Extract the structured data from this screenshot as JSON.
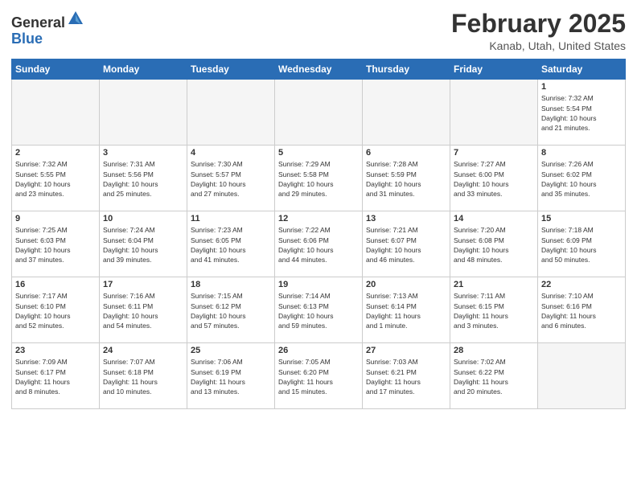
{
  "header": {
    "logo_line1": "General",
    "logo_line2": "Blue",
    "title": "February 2025",
    "subtitle": "Kanab, Utah, United States"
  },
  "weekdays": [
    "Sunday",
    "Monday",
    "Tuesday",
    "Wednesday",
    "Thursday",
    "Friday",
    "Saturday"
  ],
  "weeks": [
    [
      {
        "day": "",
        "info": ""
      },
      {
        "day": "",
        "info": ""
      },
      {
        "day": "",
        "info": ""
      },
      {
        "day": "",
        "info": ""
      },
      {
        "day": "",
        "info": ""
      },
      {
        "day": "",
        "info": ""
      },
      {
        "day": "1",
        "info": "Sunrise: 7:32 AM\nSunset: 5:54 PM\nDaylight: 10 hours\nand 21 minutes."
      }
    ],
    [
      {
        "day": "2",
        "info": "Sunrise: 7:32 AM\nSunset: 5:55 PM\nDaylight: 10 hours\nand 23 minutes."
      },
      {
        "day": "3",
        "info": "Sunrise: 7:31 AM\nSunset: 5:56 PM\nDaylight: 10 hours\nand 25 minutes."
      },
      {
        "day": "4",
        "info": "Sunrise: 7:30 AM\nSunset: 5:57 PM\nDaylight: 10 hours\nand 27 minutes."
      },
      {
        "day": "5",
        "info": "Sunrise: 7:29 AM\nSunset: 5:58 PM\nDaylight: 10 hours\nand 29 minutes."
      },
      {
        "day": "6",
        "info": "Sunrise: 7:28 AM\nSunset: 5:59 PM\nDaylight: 10 hours\nand 31 minutes."
      },
      {
        "day": "7",
        "info": "Sunrise: 7:27 AM\nSunset: 6:00 PM\nDaylight: 10 hours\nand 33 minutes."
      },
      {
        "day": "8",
        "info": "Sunrise: 7:26 AM\nSunset: 6:02 PM\nDaylight: 10 hours\nand 35 minutes."
      }
    ],
    [
      {
        "day": "9",
        "info": "Sunrise: 7:25 AM\nSunset: 6:03 PM\nDaylight: 10 hours\nand 37 minutes."
      },
      {
        "day": "10",
        "info": "Sunrise: 7:24 AM\nSunset: 6:04 PM\nDaylight: 10 hours\nand 39 minutes."
      },
      {
        "day": "11",
        "info": "Sunrise: 7:23 AM\nSunset: 6:05 PM\nDaylight: 10 hours\nand 41 minutes."
      },
      {
        "day": "12",
        "info": "Sunrise: 7:22 AM\nSunset: 6:06 PM\nDaylight: 10 hours\nand 44 minutes."
      },
      {
        "day": "13",
        "info": "Sunrise: 7:21 AM\nSunset: 6:07 PM\nDaylight: 10 hours\nand 46 minutes."
      },
      {
        "day": "14",
        "info": "Sunrise: 7:20 AM\nSunset: 6:08 PM\nDaylight: 10 hours\nand 48 minutes."
      },
      {
        "day": "15",
        "info": "Sunrise: 7:18 AM\nSunset: 6:09 PM\nDaylight: 10 hours\nand 50 minutes."
      }
    ],
    [
      {
        "day": "16",
        "info": "Sunrise: 7:17 AM\nSunset: 6:10 PM\nDaylight: 10 hours\nand 52 minutes."
      },
      {
        "day": "17",
        "info": "Sunrise: 7:16 AM\nSunset: 6:11 PM\nDaylight: 10 hours\nand 54 minutes."
      },
      {
        "day": "18",
        "info": "Sunrise: 7:15 AM\nSunset: 6:12 PM\nDaylight: 10 hours\nand 57 minutes."
      },
      {
        "day": "19",
        "info": "Sunrise: 7:14 AM\nSunset: 6:13 PM\nDaylight: 10 hours\nand 59 minutes."
      },
      {
        "day": "20",
        "info": "Sunrise: 7:13 AM\nSunset: 6:14 PM\nDaylight: 11 hours\nand 1 minute."
      },
      {
        "day": "21",
        "info": "Sunrise: 7:11 AM\nSunset: 6:15 PM\nDaylight: 11 hours\nand 3 minutes."
      },
      {
        "day": "22",
        "info": "Sunrise: 7:10 AM\nSunset: 6:16 PM\nDaylight: 11 hours\nand 6 minutes."
      }
    ],
    [
      {
        "day": "23",
        "info": "Sunrise: 7:09 AM\nSunset: 6:17 PM\nDaylight: 11 hours\nand 8 minutes."
      },
      {
        "day": "24",
        "info": "Sunrise: 7:07 AM\nSunset: 6:18 PM\nDaylight: 11 hours\nand 10 minutes."
      },
      {
        "day": "25",
        "info": "Sunrise: 7:06 AM\nSunset: 6:19 PM\nDaylight: 11 hours\nand 13 minutes."
      },
      {
        "day": "26",
        "info": "Sunrise: 7:05 AM\nSunset: 6:20 PM\nDaylight: 11 hours\nand 15 minutes."
      },
      {
        "day": "27",
        "info": "Sunrise: 7:03 AM\nSunset: 6:21 PM\nDaylight: 11 hours\nand 17 minutes."
      },
      {
        "day": "28",
        "info": "Sunrise: 7:02 AM\nSunset: 6:22 PM\nDaylight: 11 hours\nand 20 minutes."
      },
      {
        "day": "",
        "info": ""
      }
    ]
  ]
}
